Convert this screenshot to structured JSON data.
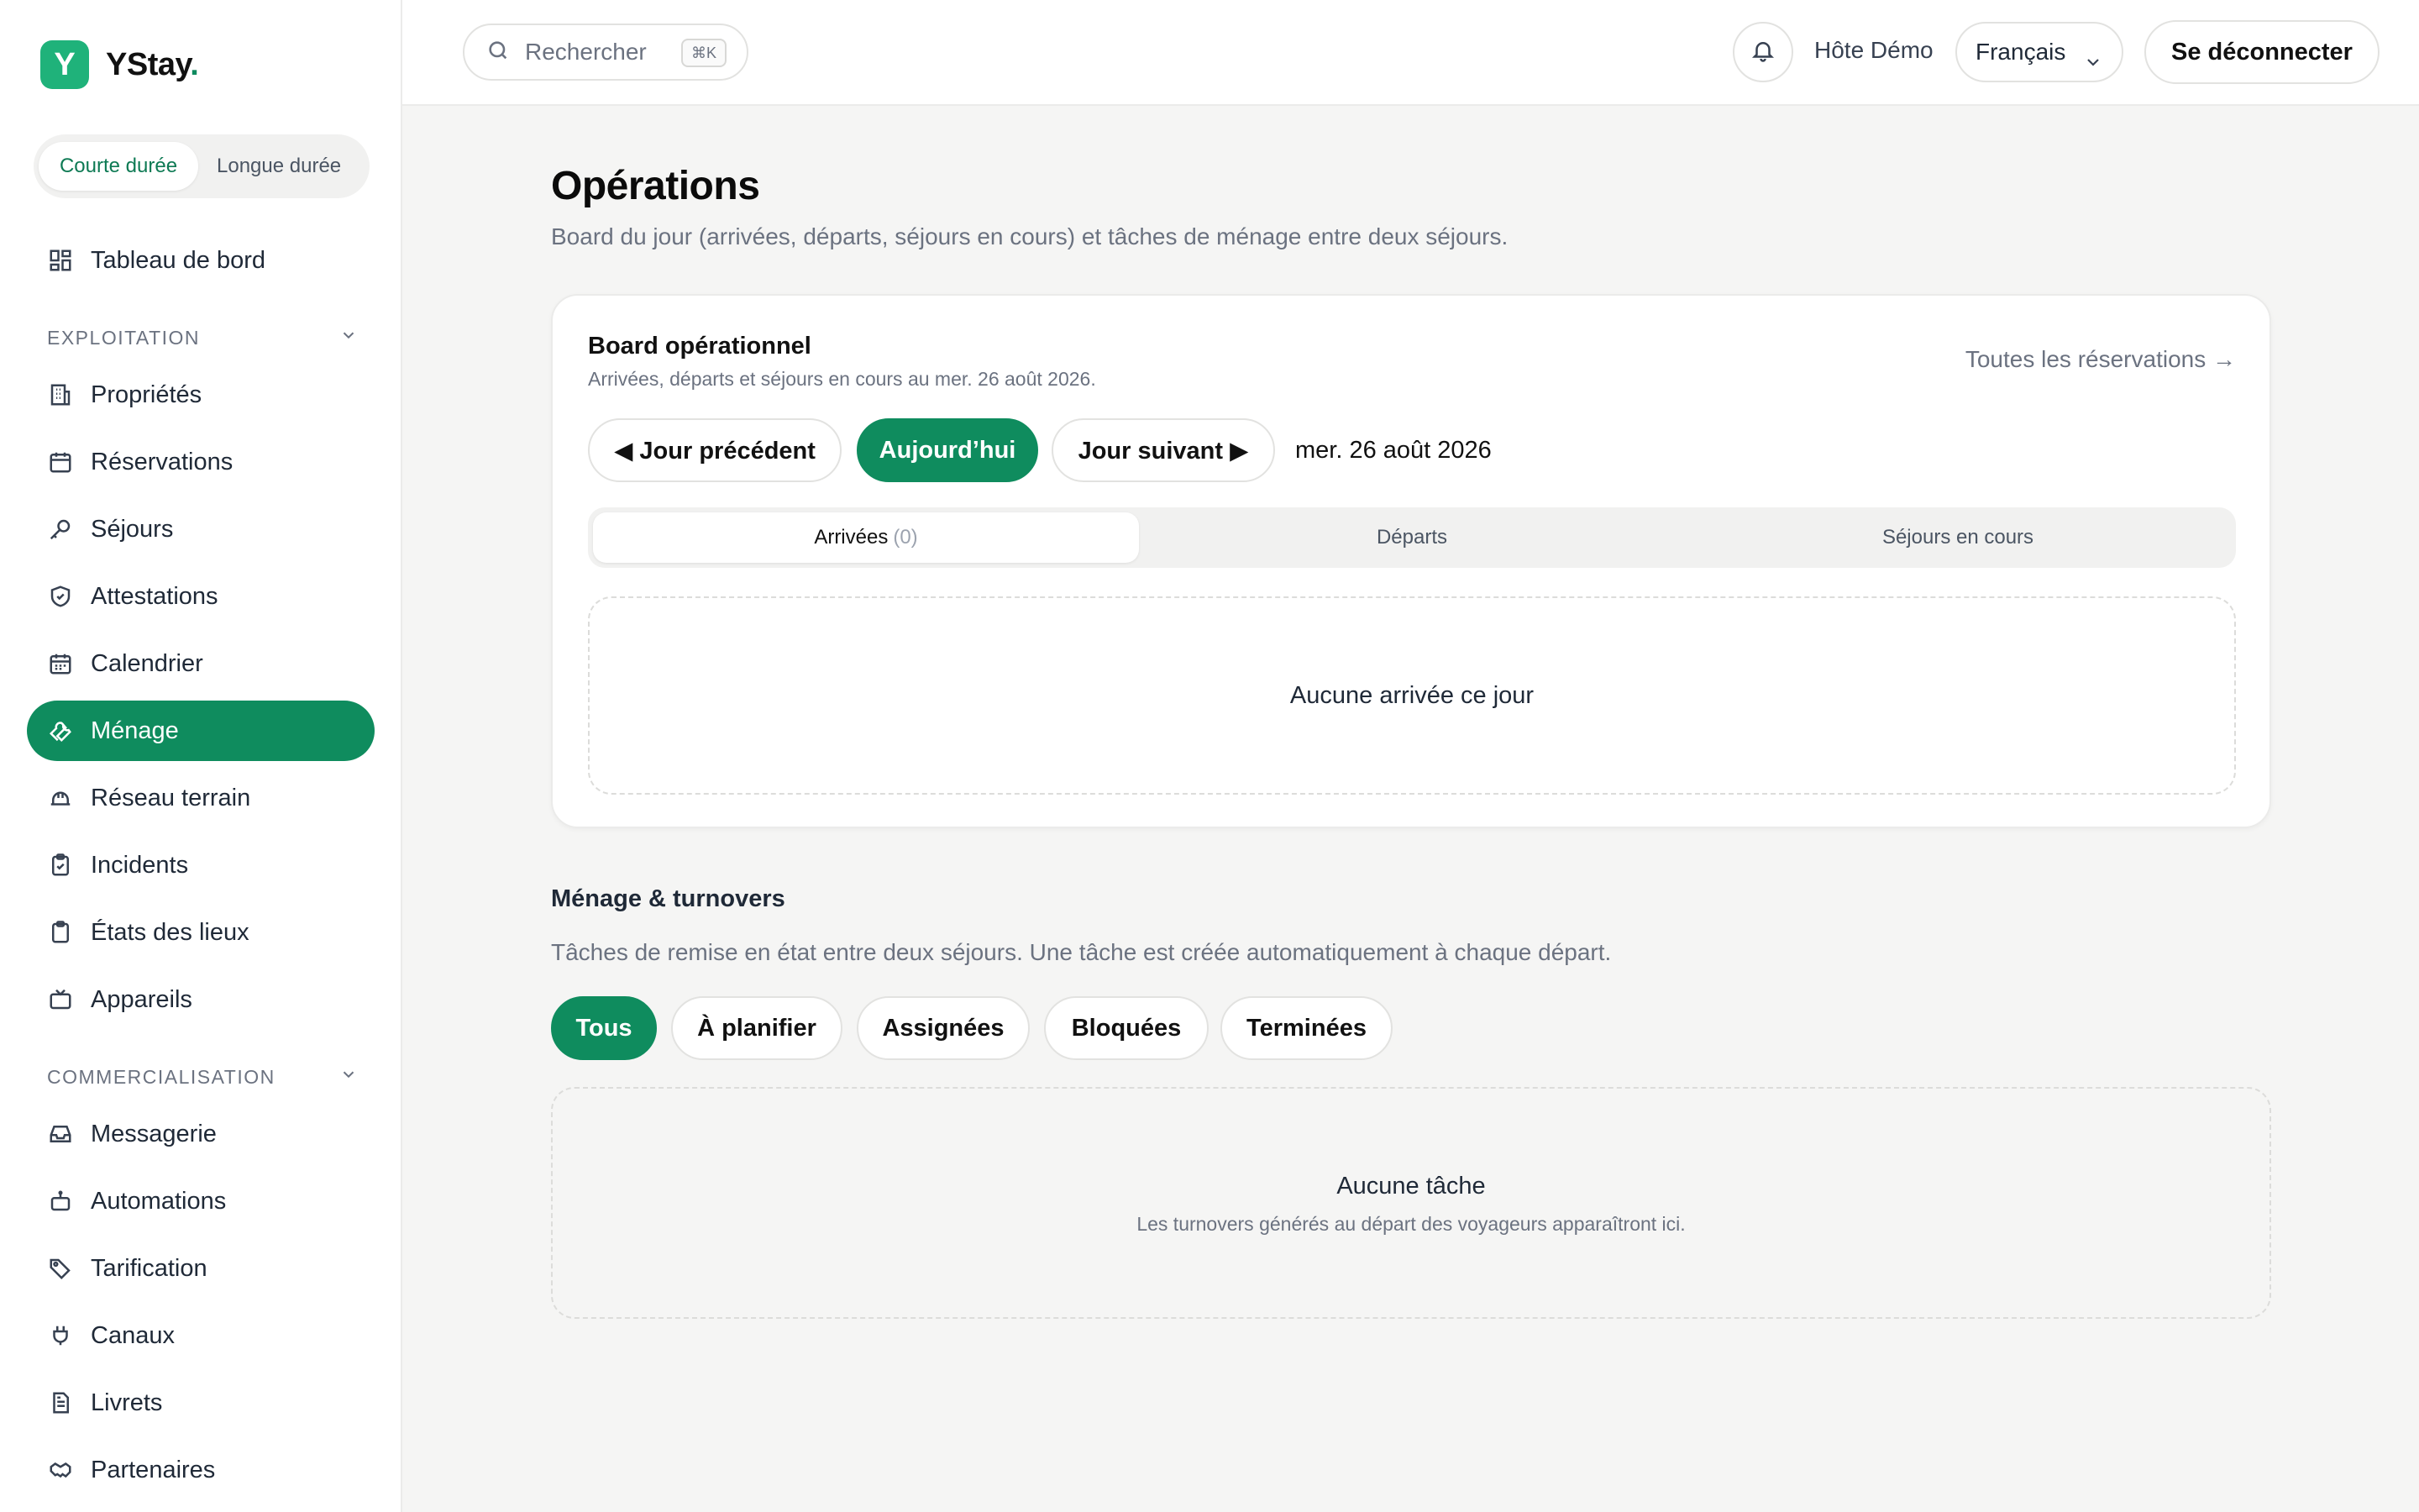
{
  "brand": {
    "name": "YStay",
    "dot": ".",
    "mark": "Y"
  },
  "mode_switch": {
    "short_term": "Courte durée",
    "long_term": "Longue durée"
  },
  "sidebar": {
    "dashboard": "Tableau de bord",
    "sections": [
      {
        "label": "EXPLOITATION"
      },
      {
        "label": "COMMERCIALISATION"
      }
    ],
    "items": [
      {
        "label": "Propriétés",
        "icon": "building-icon"
      },
      {
        "label": "Réservations",
        "icon": "calendar-icon"
      },
      {
        "label": "Séjours",
        "icon": "key-icon"
      },
      {
        "label": "Attestations",
        "icon": "shield-check-icon"
      },
      {
        "label": "Calendrier",
        "icon": "calendar-grid-icon"
      },
      {
        "label": "Ménage",
        "icon": "wrench-icon",
        "active": true
      },
      {
        "label": "Réseau terrain",
        "icon": "hard-hat-icon"
      },
      {
        "label": "Incidents",
        "icon": "clipboard-check-icon"
      },
      {
        "label": "États des lieux",
        "icon": "clipboard-icon"
      },
      {
        "label": "Appareils",
        "icon": "tv-icon"
      },
      {
        "label": "Messagerie",
        "icon": "inbox-icon"
      },
      {
        "label": "Automations",
        "icon": "bot-icon"
      },
      {
        "label": "Tarification",
        "icon": "tags-icon"
      },
      {
        "label": "Canaux",
        "icon": "plug-icon"
      },
      {
        "label": "Livrets",
        "icon": "file-text-icon"
      },
      {
        "label": "Partenaires",
        "icon": "handshake-icon"
      }
    ]
  },
  "topbar": {
    "search_placeholder": "Rechercher",
    "shortcut": "⌘K",
    "user": "Hôte Démo",
    "language": "Français",
    "logout": "Se déconnecter"
  },
  "page": {
    "title": "Opérations",
    "subtitle": "Board du jour (arrivées, départs, séjours en cours) et tâches de ménage entre deux séjours."
  },
  "board": {
    "title": "Board opérationnel",
    "subtitle": "Arrivées, départs et séjours en cours au mer. 26 août 2026.",
    "all_reservations": "Toutes les réservations →",
    "prev_day": "◀ Jour précédent",
    "today": "Aujourd’hui",
    "next_day": "Jour suivant ▶",
    "current_date": "mer. 26 août 2026",
    "tabs": [
      {
        "label": "Arrivées",
        "count": "(0)",
        "active": true
      },
      {
        "label": "Départs",
        "count": ""
      },
      {
        "label": "Séjours en cours",
        "count": ""
      }
    ],
    "empty": "Aucune arrivée ce jour"
  },
  "turnovers": {
    "title": "Ménage & turnovers",
    "subtitle": "Tâches de remise en état entre deux séjours. Une tâche est créée automatiquement à chaque départ.",
    "filters": [
      "Tous",
      "À planifier",
      "Assignées",
      "Bloquées",
      "Terminées"
    ],
    "active_filter": "Tous",
    "empty_title": "Aucune tâche",
    "empty_sub": "Les turnovers générés au départ des voyageurs apparaîtront ici."
  },
  "colors": {
    "accent": "#0f8c5e",
    "logo": "#1fb27a",
    "background": "#f5f5f4"
  }
}
